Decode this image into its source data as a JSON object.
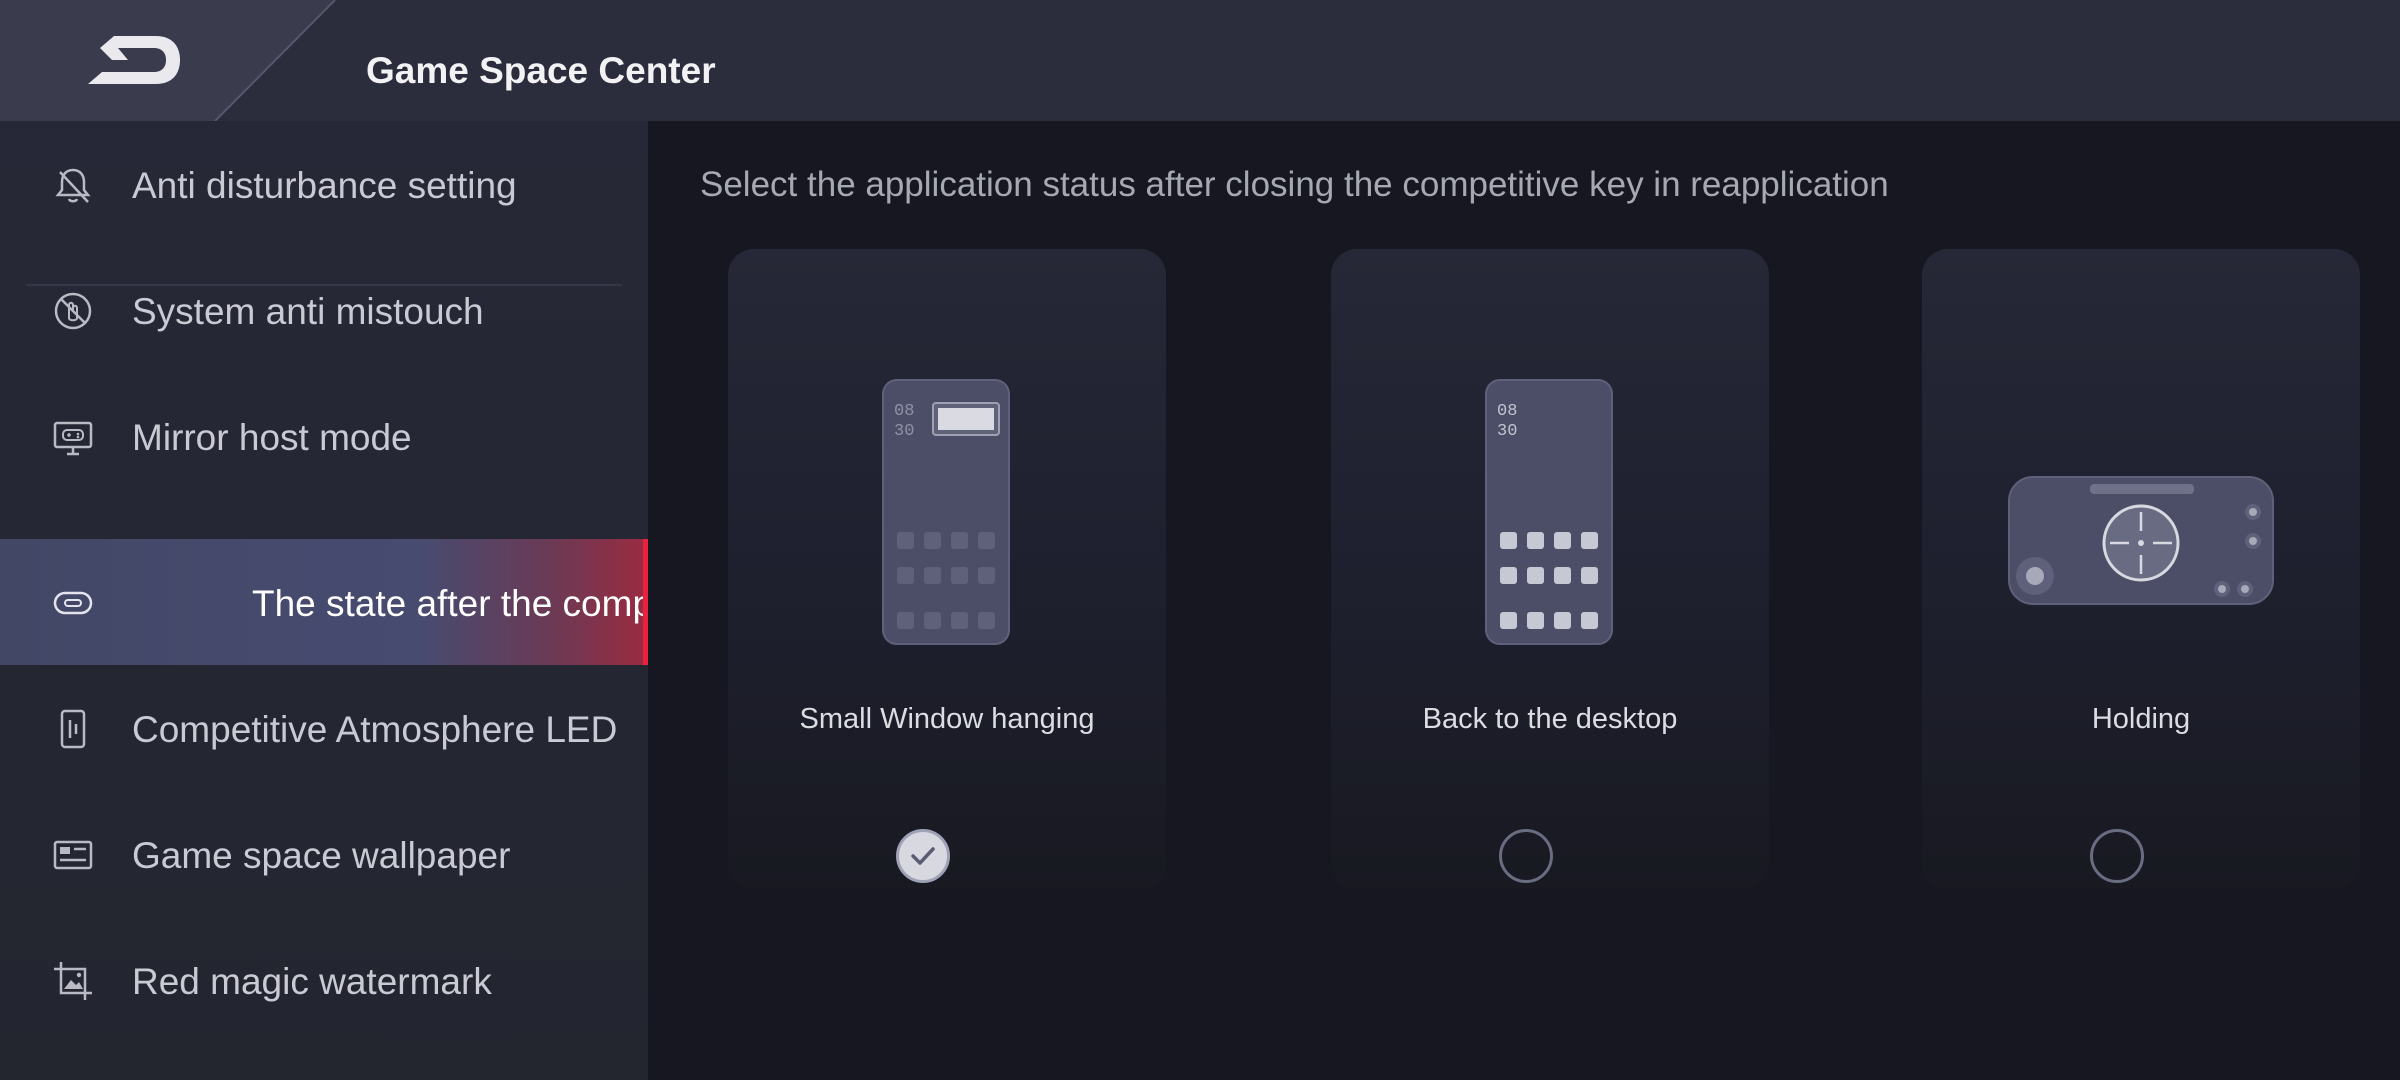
{
  "header": {
    "title": "Game Space Center"
  },
  "sidebar": {
    "items": [
      {
        "label": "Anti disturbance setting",
        "icon": "bell-off-icon"
      },
      {
        "label": "System anti mistouch",
        "icon": "no-touch-icon"
      },
      {
        "label": "Mirror host mode",
        "icon": "monitor-gamepad-icon"
      },
      {
        "label": "The state after the comp",
        "icon": "toggle-key-icon",
        "active": true
      },
      {
        "label": "Competitive Atmosphere LED",
        "icon": "led-strip-icon"
      },
      {
        "label": "Game space wallpaper",
        "icon": "wallpaper-icon"
      },
      {
        "label": "Red magic watermark",
        "icon": "image-crop-icon"
      }
    ]
  },
  "main": {
    "prompt": "Select the application status after closing the competitive key in reapplication",
    "options": [
      {
        "label": "Small Window hanging",
        "selected": true
      },
      {
        "label": "Back to the desktop",
        "selected": false
      },
      {
        "label": "Holding",
        "selected": false
      }
    ],
    "phone_clock": [
      "08",
      "30"
    ]
  },
  "colors": {
    "accent": "#e8223f",
    "active_bg": "#474b70",
    "header_bg": "#2b2d3c",
    "main_bg": "#161720"
  }
}
